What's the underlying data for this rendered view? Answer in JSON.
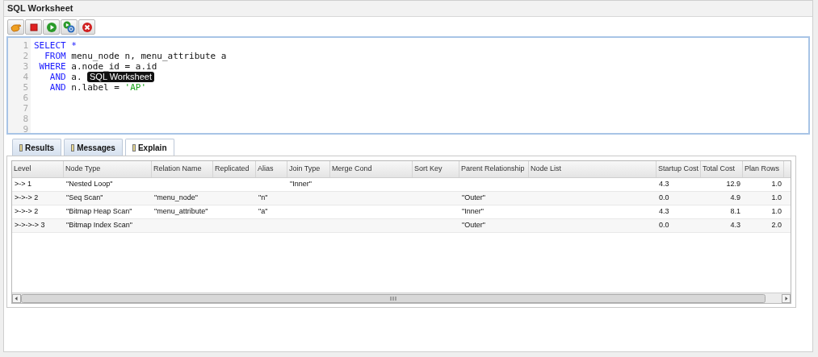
{
  "window": {
    "title": "SQL Worksheet"
  },
  "toolbar": [
    {
      "kind": "run"
    },
    {
      "kind": "stop"
    },
    {
      "kind": "execute"
    },
    {
      "kind": "explain"
    },
    {
      "kind": "cancel"
    }
  ],
  "editor": {
    "lines": [
      {
        "number": "1",
        "segments": [
          {
            "kind": "keyword",
            "text": "SELECT *"
          }
        ]
      },
      {
        "number": "2",
        "segments": [
          {
            "kind": "keyword",
            "text": "  FROM"
          },
          {
            "kind": "plain",
            "text": " menu_node n, menu_attribute a"
          }
        ]
      },
      {
        "number": "3",
        "segments": [
          {
            "kind": "keyword",
            "text": " WHERE"
          },
          {
            "kind": "plain",
            "text": " a.node_id = a.id"
          }
        ]
      },
      {
        "number": "4",
        "segments": [
          {
            "kind": "keyword",
            "text": "   AND"
          },
          {
            "kind": "plain",
            "text": " a."
          }
        ]
      },
      {
        "number": "5",
        "segments": [
          {
            "kind": "keyword",
            "text": "   AND"
          },
          {
            "kind": "plain",
            "text": " n.label = "
          },
          {
            "kind": "string",
            "text": "'AP'"
          }
        ]
      },
      {
        "number": "6"
      },
      {
        "number": "7"
      },
      {
        "number": "8"
      },
      {
        "number": "9"
      }
    ],
    "tooltip": "SQL Worksheet"
  },
  "tabs": [
    {
      "label": "Results",
      "selected": false
    },
    {
      "label": "Messages",
      "selected": false
    },
    {
      "label": "Explain",
      "selected": true
    }
  ],
  "table": {
    "columns": [
      "Level",
      "Node Type",
      "Relation Name",
      "Replicated",
      "Alias",
      "Join Type",
      "Merge Cond",
      "Sort Key",
      "Parent Relationship",
      "Node List",
      "Startup Cost",
      "Total Cost",
      "Plan Rows"
    ],
    "rows": [
      [
        ">-> 1",
        "\"Nested Loop\"",
        "",
        "",
        "",
        "\"Inner\"",
        "",
        "",
        "",
        "",
        "4.3",
        "12.9",
        "1.0"
      ],
      [
        ">->-> 2",
        "\"Seq Scan\"",
        "\"menu_node\"",
        "",
        "\"n\"",
        "",
        "",
        "",
        "\"Outer\"",
        "",
        "0.0",
        "4.9",
        "1.0"
      ],
      [
        ">->-> 2",
        "\"Bitmap Heap Scan\"",
        "\"menu_attribute\"",
        "",
        "\"a\"",
        "",
        "",
        "",
        "\"Inner\"",
        "",
        "4.3",
        "8.1",
        "1.0"
      ],
      [
        ">->->-> 3",
        "\"Bitmap Index Scan\"",
        "",
        "",
        "",
        "",
        "",
        "",
        "\"Outer\"",
        "",
        "0.0",
        "4.3",
        "2.0"
      ]
    ]
  }
}
